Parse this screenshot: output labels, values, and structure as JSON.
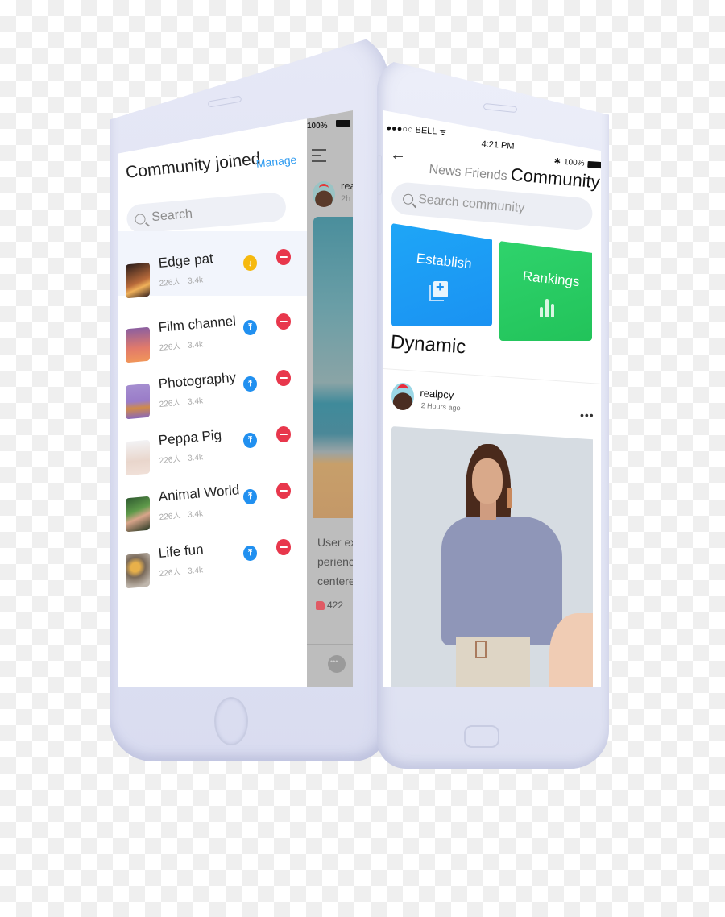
{
  "left_phone": {
    "drawer": {
      "title": "Community joined",
      "manage_label": "Manage",
      "search_placeholder": "Search",
      "communities": [
        {
          "name": "Edge pat",
          "members": "226人",
          "posts": "3.4k",
          "action": "download",
          "active": true
        },
        {
          "name": "Film channel",
          "members": "226人",
          "posts": "3.4k",
          "action": "pin",
          "active": false
        },
        {
          "name": "Photography",
          "members": "226人",
          "posts": "3.4k",
          "action": "pin",
          "active": false
        },
        {
          "name": "Peppa Pig",
          "members": "226人",
          "posts": "3.4k",
          "action": "pin",
          "active": false
        },
        {
          "name": "Animal World",
          "members": "226人",
          "posts": "3.4k",
          "action": "pin",
          "active": false
        },
        {
          "name": "Life fun",
          "members": "226人",
          "posts": "3.4k",
          "action": "pin",
          "active": false
        }
      ]
    },
    "feed_behind": {
      "status": "100%",
      "user": "rea",
      "time": "2h",
      "caption_lines": [
        "User ex",
        "perience",
        "centered"
      ],
      "likes": "422"
    }
  },
  "right_phone": {
    "status_bar": {
      "carrier": "●●●○○ BELL",
      "time": "4:21 PM",
      "battery": "100%"
    },
    "tabs": [
      {
        "label": "News",
        "active": false
      },
      {
        "label": "Friends",
        "active": false
      },
      {
        "label": "Community",
        "active": true
      }
    ],
    "search_placeholder": "Search community",
    "tiles": {
      "establish": "Establish",
      "rankings": "Rankings"
    },
    "section_title": "Dynamic",
    "post": {
      "user": "realpcy",
      "time": "2 Hours ago",
      "more": "•••"
    }
  },
  "colors": {
    "accent_blue": "#2190f0",
    "download_yellow": "#f6b90f",
    "remove_red": "#e8374c",
    "establish_blue": "#1a92f2",
    "rankings_green": "#22c35a",
    "phone_body": "#e3e6f5"
  }
}
